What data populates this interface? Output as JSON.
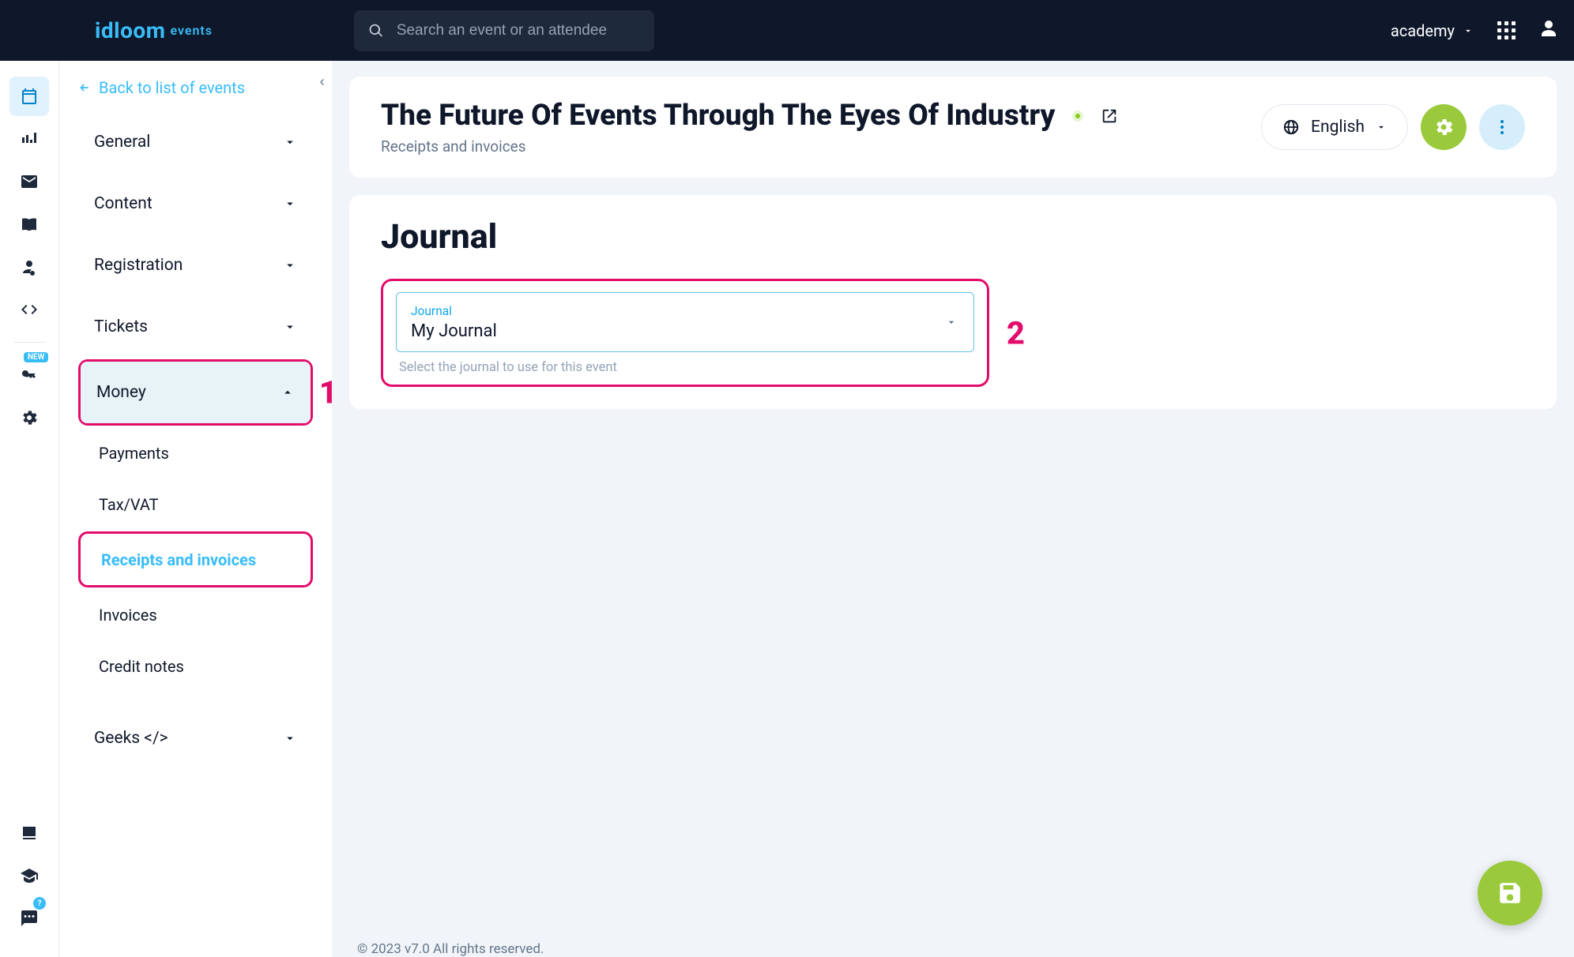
{
  "header": {
    "logo_main": "idloom",
    "logo_sub": "events",
    "search_placeholder": "Search an event or an attendee",
    "account_label": "academy"
  },
  "sidebar": {
    "back_label": "Back to list of events",
    "items": [
      {
        "label": "General"
      },
      {
        "label": "Content"
      },
      {
        "label": "Registration"
      },
      {
        "label": "Tickets"
      },
      {
        "label": "Money"
      },
      {
        "label": "Geeks </>"
      }
    ],
    "money_subitems": [
      {
        "label": "Payments"
      },
      {
        "label": "Tax/VAT"
      },
      {
        "label": "Receipts and invoices"
      },
      {
        "label": "Invoices"
      },
      {
        "label": "Credit notes"
      }
    ],
    "annotations": {
      "money_marker": "1",
      "journal_marker": "2"
    },
    "badges": {
      "new": "NEW",
      "help": "?"
    }
  },
  "event_header": {
    "title": "The Future Of Events Through The Eyes Of Industry",
    "subtitle": "Receipts and invoices",
    "language": "English"
  },
  "journal_card": {
    "heading": "Journal",
    "field_label": "Journal",
    "field_value": "My Journal",
    "helper": "Select the journal to use for this event"
  },
  "footer": "© 2023 v7.0 All rights reserved."
}
